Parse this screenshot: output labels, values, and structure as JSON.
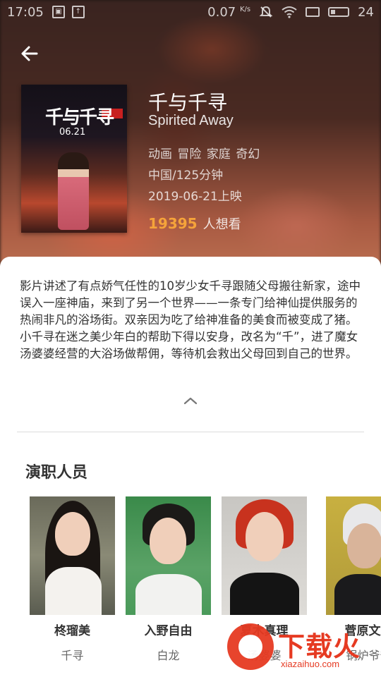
{
  "status_bar": {
    "time": "17:05",
    "net_speed": "0.07",
    "net_unit": "K/s",
    "battery": "24"
  },
  "movie": {
    "title": "千与千寻",
    "en_title": "Spirited Away",
    "genres": "动画 冒险 家庭 奇幻",
    "region_duration": "中国/125分钟",
    "release": "2019-06-21上映",
    "want_count": "19395",
    "want_label": "人想看"
  },
  "poster": {
    "title": "千与千寻",
    "date": "06.21"
  },
  "synopsis": "影片讲述了有点娇气任性的10岁少女千寻跟随父母搬往新家，途中误入一座神庙，来到了另一个世界——一条专门给神仙提供服务的热闹非凡的浴场街。双亲因为吃了给神准备的美食而被变成了猪。小千寻在迷之美少年白的帮助下得以安身，改名为“千”，进了魔女汤婆婆经营的大浴场做帮佣，等待机会救出父母回到自己的世界。",
  "cast_section": {
    "title": "演职人员",
    "members": [
      {
        "name": "柊瑠美",
        "role": "千寻"
      },
      {
        "name": "入野自由",
        "role": "白龙"
      },
      {
        "name": "夏木真理",
        "role": "汤婆婆"
      },
      {
        "name": "菅原文太",
        "role": "锅炉爷爷"
      }
    ]
  },
  "watermark": {
    "text": "下载火",
    "url": "xiazaihuo.com"
  },
  "colors": {
    "accent": "#f5a33a",
    "watermark": "#e63a22"
  }
}
